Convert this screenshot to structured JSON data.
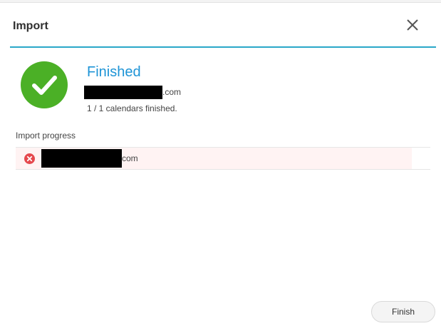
{
  "dialog": {
    "title": "Import",
    "close_icon": "close-icon"
  },
  "status": {
    "icon": "check-circle-icon",
    "icon_color": "#4bb026",
    "title": "Finished",
    "title_color": "#1e94d6",
    "account_suffix": ".com",
    "summary": "1 / 1 calendars finished."
  },
  "progress": {
    "label": "Import progress",
    "items": [
      {
        "icon": "error-icon",
        "icon_color": "#e5484d",
        "suffix": "com"
      }
    ]
  },
  "footer": {
    "finish_label": "Finish"
  },
  "accent": "#2aa7c9"
}
